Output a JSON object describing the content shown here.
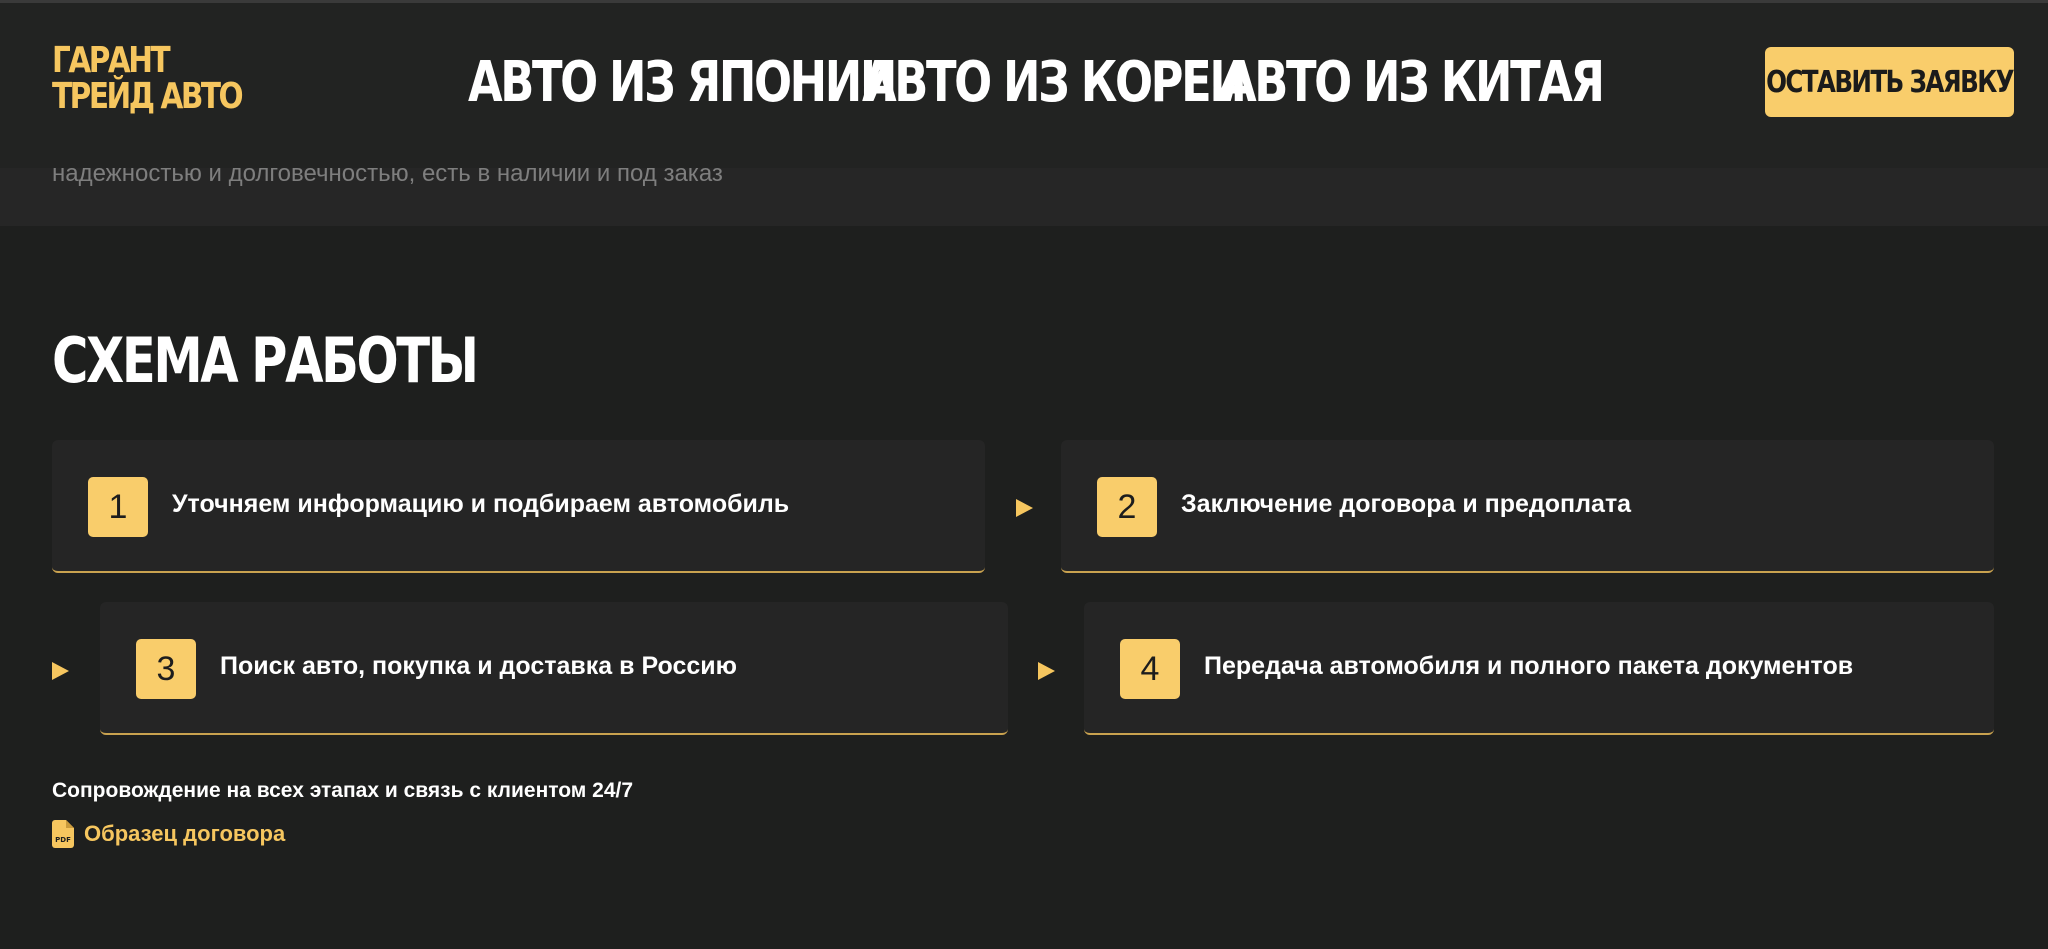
{
  "header": {
    "logo_line1": "ГАРАНТ",
    "logo_line2": "ТРЕЙД АВТО",
    "nav": [
      {
        "label": "АВТО ИЗ ЯПОНИИ"
      },
      {
        "label": "АВТО ИЗ КОРЕИ"
      },
      {
        "label": "АВТО ИЗ КИТАЯ"
      }
    ],
    "cta_label": "ОСТАВИТЬ ЗАЯВКУ"
  },
  "hero": {
    "text": "надежностью и долговечностью, есть в наличии и под заказ"
  },
  "scheme": {
    "title": "СХЕМА РАБОТЫ",
    "steps": [
      {
        "num": "1",
        "text": "Уточняем информацию и подбираем автомобиль"
      },
      {
        "num": "2",
        "text": "Заключение договора и предоплата"
      },
      {
        "num": "3",
        "text": "Поиск авто, покупка и доставка в Россию"
      },
      {
        "num": "4",
        "text": "Передача автомобиля и полного пакета документов"
      }
    ],
    "support_text": "Сопровождение на всех этапах и связь с клиентом 24/7",
    "pdf_link_label": "Образец договора",
    "pdf_icon_text": "PDF"
  },
  "colors": {
    "accent": "#f9cd6b",
    "background": "#1e1f1e",
    "card": "#252525"
  }
}
